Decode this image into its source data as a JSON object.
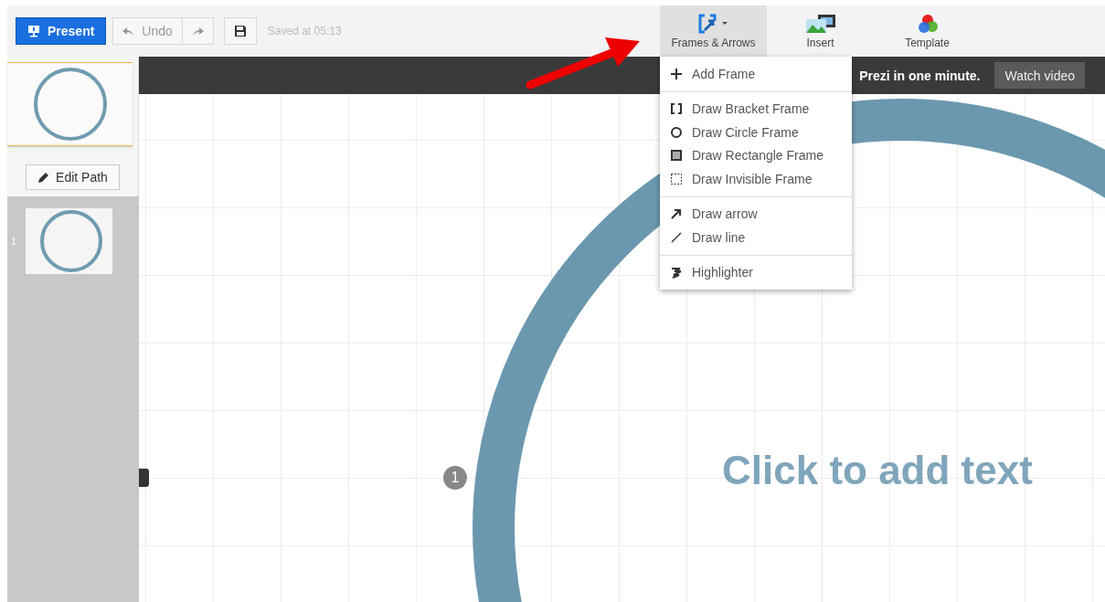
{
  "toolbar": {
    "present": "Present",
    "undo": "Undo",
    "saved": "Saved at 05:13"
  },
  "tools": [
    {
      "kind": "frames",
      "label": "Frames & Arrows",
      "selected": true
    },
    {
      "kind": "insert",
      "label": "Insert",
      "selected": false
    },
    {
      "kind": "template",
      "label": "Template",
      "selected": false
    }
  ],
  "banner": {
    "text": "Prezi in one minute.",
    "button": "Watch video"
  },
  "menu": [
    [
      {
        "kind": "plus",
        "label": "Add Frame"
      }
    ],
    [
      {
        "kind": "bracket",
        "label": "Draw Bracket Frame"
      },
      {
        "kind": "circle",
        "label": "Draw Circle Frame"
      },
      {
        "kind": "rectangle",
        "label": "Draw Rectangle Frame"
      },
      {
        "kind": "invisible",
        "label": "Draw Invisible Frame"
      }
    ],
    [
      {
        "kind": "arrow",
        "label": "Draw arrow"
      },
      {
        "kind": "line",
        "label": "Draw line"
      }
    ],
    [
      {
        "kind": "highlighter",
        "label": "Highlighter"
      }
    ]
  ],
  "sidebar": {
    "edit_path": "Edit Path",
    "slides": [
      {
        "number": "1"
      }
    ]
  },
  "canvas": {
    "placeholder": "Click to add text",
    "path_point": "1"
  }
}
